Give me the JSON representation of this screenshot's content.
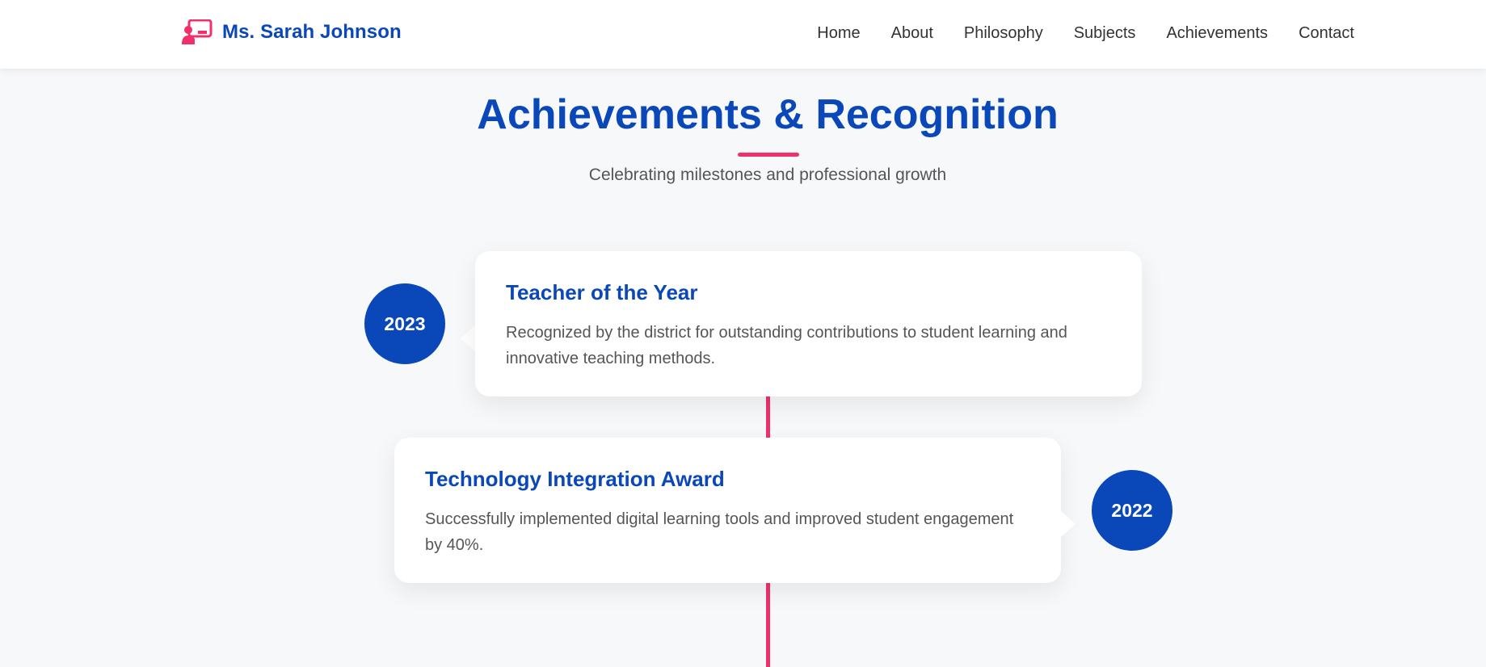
{
  "nav": {
    "brand": {
      "name": "Ms. Sarah Johnson",
      "icon": "teacher-icon"
    },
    "links": [
      "Home",
      "About",
      "Philosophy",
      "Subjects",
      "Achievements",
      "Contact"
    ]
  },
  "section": {
    "title": "Achievements & Recognition",
    "subtitle": "Celebrating milestones and professional growth"
  },
  "timeline": [
    {
      "year": "2023",
      "title": "Teacher of the Year",
      "description": "Recognized by the district for outstanding contributions to student learning and innovative teaching methods."
    },
    {
      "year": "2022",
      "title": "Technology Integration Award",
      "description": "Successfully implemented digital learning tools and improved student engagement by 40%."
    }
  ],
  "colors": {
    "primary": "#0a47b8",
    "accent": "#f0306a",
    "background": "#f7f8fa",
    "text": "#555555",
    "nav_text": "#333333"
  }
}
